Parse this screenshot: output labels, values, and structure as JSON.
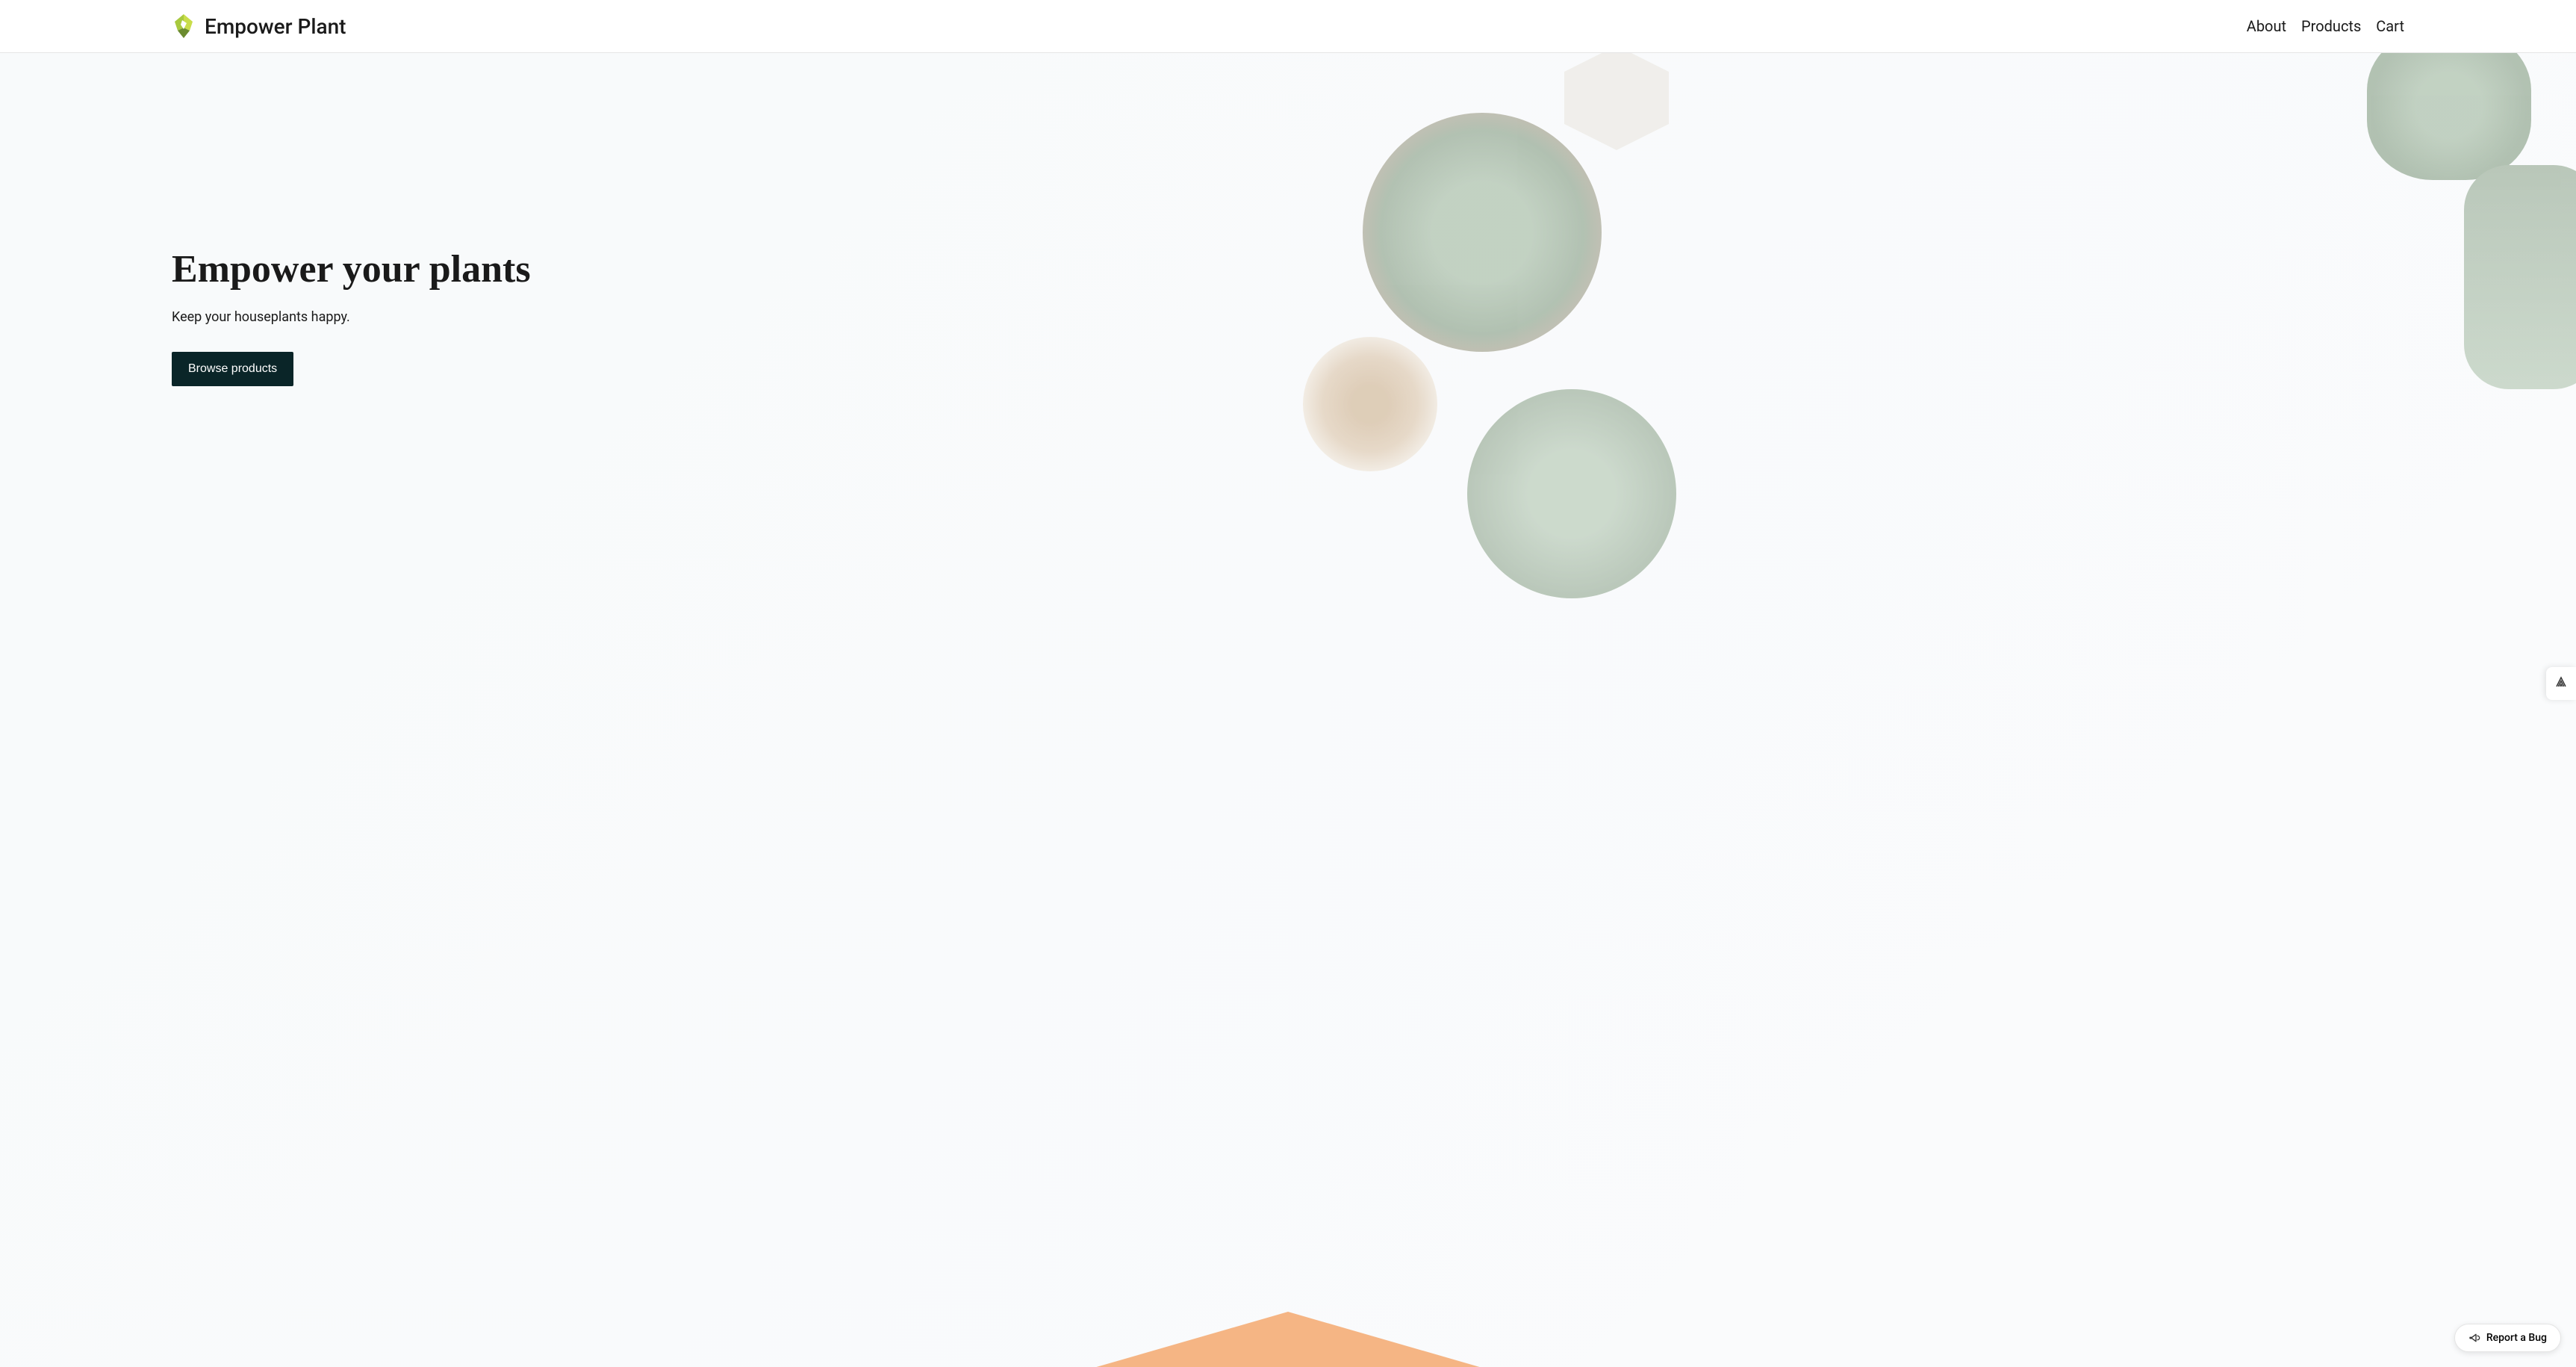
{
  "header": {
    "brand_name": "Empower Plant",
    "nav": {
      "about": "About",
      "products": "Products",
      "cart": "Cart"
    }
  },
  "hero": {
    "title": "Empower your plants",
    "subtitle": "Keep your houseplants happy.",
    "cta_label": "Browse products"
  },
  "widgets": {
    "bug_report_label": "Report a Bug"
  },
  "colors": {
    "primary_dark": "#0a2528",
    "accent_peach": "#f5b584",
    "logo_green": "#a8c93e",
    "logo_dark_green": "#6b8b2f"
  }
}
